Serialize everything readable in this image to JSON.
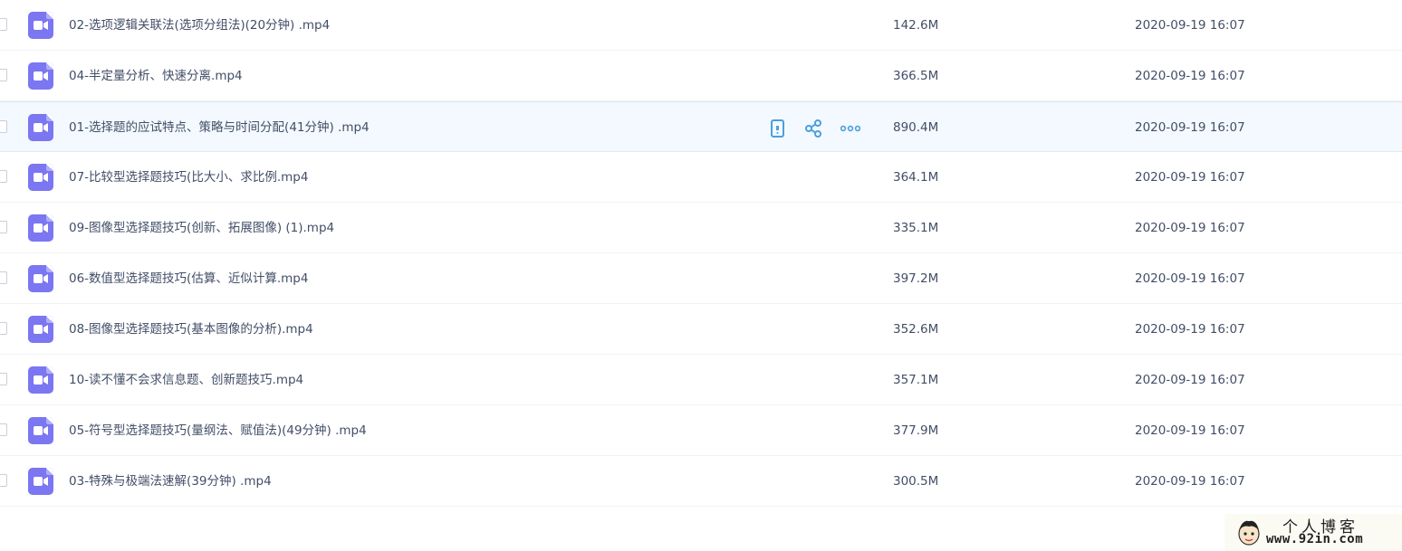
{
  "files": [
    {
      "name": "02-选项逻辑关联法(选项分组法)(20分钟) .mp4",
      "size": "142.6M",
      "date": "2020-09-19 16:07"
    },
    {
      "name": "04-半定量分析、快速分离.mp4",
      "size": "366.5M",
      "date": "2020-09-19 16:07"
    },
    {
      "name": "01-选择题的应试特点、策略与时间分配(41分钟) .mp4",
      "size": "890.4M",
      "date": "2020-09-19 16:07"
    },
    {
      "name": "07-比较型选择题技巧(比大小、求比例.mp4",
      "size": "364.1M",
      "date": "2020-09-19 16:07"
    },
    {
      "name": "09-图像型选择题技巧(创新、拓展图像) (1).mp4",
      "size": "335.1M",
      "date": "2020-09-19 16:07"
    },
    {
      "name": "06-数值型选择题技巧(估算、近似计算.mp4",
      "size": "397.2M",
      "date": "2020-09-19 16:07"
    },
    {
      "name": "08-图像型选择题技巧(基本图像的分析).mp4",
      "size": "352.6M",
      "date": "2020-09-19 16:07"
    },
    {
      "name": "10-读不懂不会求信息题、创新题技巧.mp4",
      "size": "357.1M",
      "date": "2020-09-19 16:07"
    },
    {
      "name": "05-符号型选择题技巧(量纲法、赋值法)(49分钟) .mp4",
      "size": "377.9M",
      "date": "2020-09-19 16:07"
    },
    {
      "name": "03-特殊与极端法速解(39分钟) .mp4",
      "size": "300.5M",
      "date": "2020-09-19 16:07"
    }
  ],
  "hover_row_index": 2,
  "row_actions": [
    "phone-icon",
    "share-icon",
    "more-icon"
  ],
  "icons": {
    "file": "video-file-icon"
  },
  "colors": {
    "file_icon": "#7b76f2",
    "action": "#4a9fe0",
    "hover_bg": "#f3f9fe"
  },
  "watermark": {
    "title": "个人博客",
    "url": "www.92in.com"
  }
}
